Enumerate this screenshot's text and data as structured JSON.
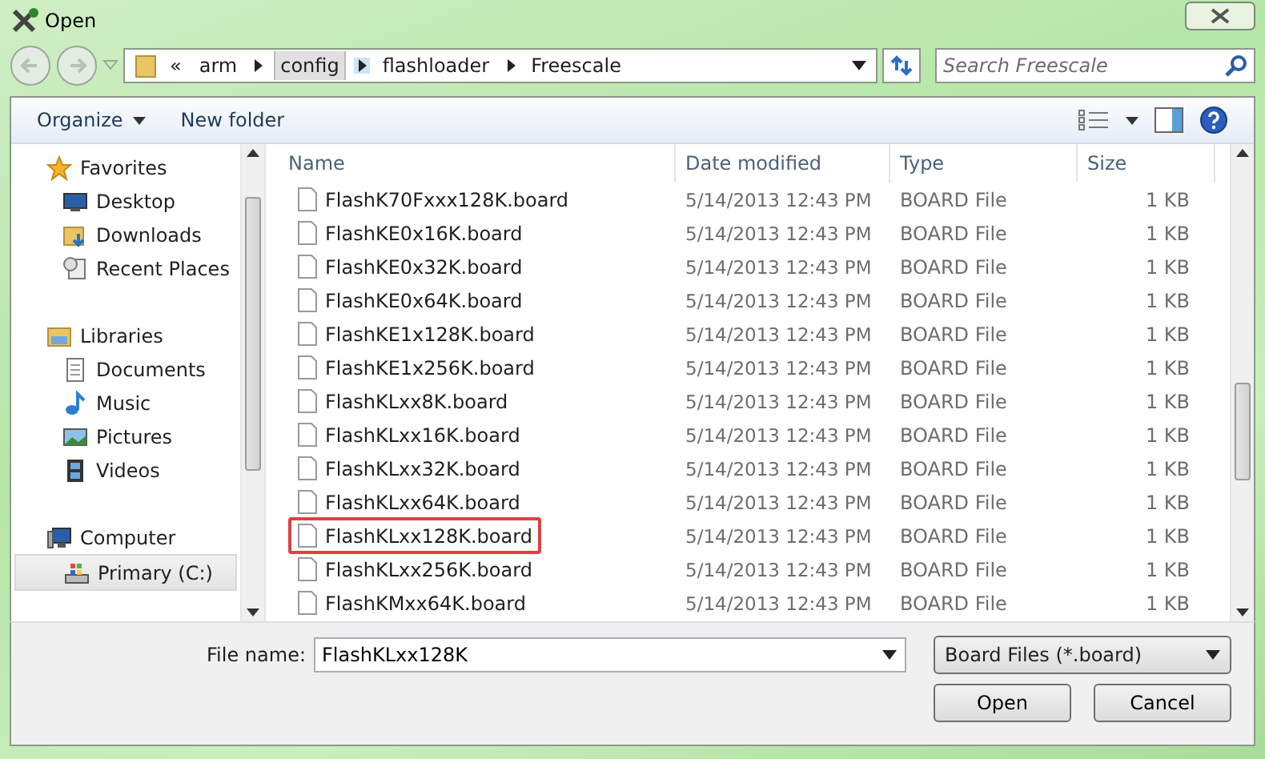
{
  "window": {
    "title": "Open"
  },
  "address": {
    "crumbs": [
      {
        "label": "«",
        "highlighted": false
      },
      {
        "label": "arm",
        "highlighted": false
      },
      {
        "label": "config",
        "highlighted": true
      },
      {
        "label": "flashloader",
        "highlighted": false
      },
      {
        "label": "Freescale",
        "highlighted": false
      }
    ]
  },
  "search": {
    "placeholder": "Search Freescale"
  },
  "toolbar": {
    "items": [
      "Organize",
      "New folder"
    ]
  },
  "sidebar": {
    "groups": [
      {
        "label": "Favorites",
        "children": [
          {
            "label": "Desktop",
            "selected": false
          },
          {
            "label": "Downloads",
            "selected": false
          },
          {
            "label": "Recent Places",
            "selected": false
          }
        ]
      },
      {
        "label": "Libraries",
        "children": [
          {
            "label": "Documents",
            "selected": false
          },
          {
            "label": "Music",
            "selected": false
          },
          {
            "label": "Pictures",
            "selected": false
          },
          {
            "label": "Videos",
            "selected": false
          }
        ]
      },
      {
        "label": "Computer",
        "children": [
          {
            "label": "Primary (C:)",
            "selected": true
          }
        ]
      }
    ]
  },
  "table": {
    "columns": [
      "Name",
      "Date modified",
      "Type",
      "Size"
    ],
    "rows": [
      {
        "name": "FlashK70Fxxx128K.board",
        "date": "5/14/2013 12:43 PM",
        "type": "BOARD File",
        "size": "1 KB",
        "highlighted": false
      },
      {
        "name": "FlashKE0x16K.board",
        "date": "5/14/2013 12:43 PM",
        "type": "BOARD File",
        "size": "1 KB",
        "highlighted": false
      },
      {
        "name": "FlashKE0x32K.board",
        "date": "5/14/2013 12:43 PM",
        "type": "BOARD File",
        "size": "1 KB",
        "highlighted": false
      },
      {
        "name": "FlashKE0x64K.board",
        "date": "5/14/2013 12:43 PM",
        "type": "BOARD File",
        "size": "1 KB",
        "highlighted": false
      },
      {
        "name": "FlashKE1x128K.board",
        "date": "5/14/2013 12:43 PM",
        "type": "BOARD File",
        "size": "1 KB",
        "highlighted": false
      },
      {
        "name": "FlashKE1x256K.board",
        "date": "5/14/2013 12:43 PM",
        "type": "BOARD File",
        "size": "1 KB",
        "highlighted": false
      },
      {
        "name": "FlashKLxx8K.board",
        "date": "5/14/2013 12:43 PM",
        "type": "BOARD File",
        "size": "1 KB",
        "highlighted": false
      },
      {
        "name": "FlashKLxx16K.board",
        "date": "5/14/2013 12:43 PM",
        "type": "BOARD File",
        "size": "1 KB",
        "highlighted": false
      },
      {
        "name": "FlashKLxx32K.board",
        "date": "5/14/2013 12:43 PM",
        "type": "BOARD File",
        "size": "1 KB",
        "highlighted": false
      },
      {
        "name": "FlashKLxx64K.board",
        "date": "5/14/2013 12:43 PM",
        "type": "BOARD File",
        "size": "1 KB",
        "highlighted": false
      },
      {
        "name": "FlashKLxx128K.board",
        "date": "5/14/2013 12:43 PM",
        "type": "BOARD File",
        "size": "1 KB",
        "highlighted": true
      },
      {
        "name": "FlashKLxx256K.board",
        "date": "5/14/2013 12:43 PM",
        "type": "BOARD File",
        "size": "1 KB",
        "highlighted": false
      },
      {
        "name": "FlashKMxx64K.board",
        "date": "5/14/2013 12:43 PM",
        "type": "BOARD File",
        "size": "1 KB",
        "highlighted": false
      }
    ]
  },
  "filename": {
    "label": "File name:",
    "value": "FlashKLxx128K"
  },
  "filter": {
    "value": "Board Files (*.board)"
  },
  "buttons": [
    "Open",
    "Cancel"
  ]
}
